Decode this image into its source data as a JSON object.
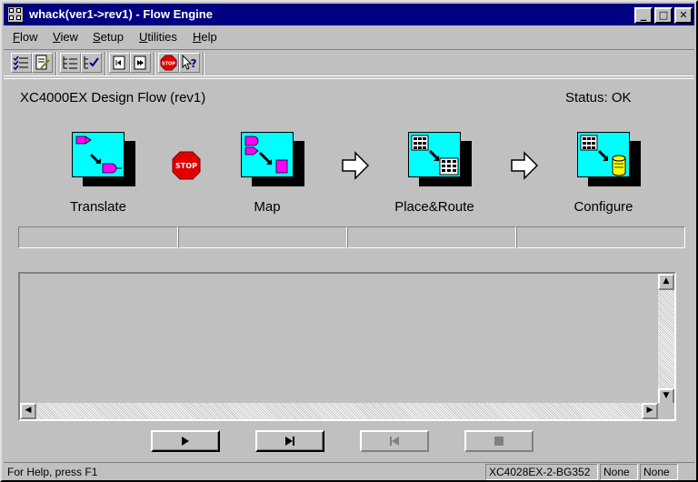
{
  "window": {
    "title": "whack(ver1->rev1) - Flow Engine",
    "minimize_label": "_",
    "maximize_label": "□",
    "close_label": "✕"
  },
  "menu": [
    {
      "key": "F",
      "rest": "low"
    },
    {
      "key": "V",
      "rest": "iew"
    },
    {
      "key": "S",
      "rest": "etup"
    },
    {
      "key": "U",
      "rest": "tilities"
    },
    {
      "key": "H",
      "rest": "elp"
    }
  ],
  "toolbar": {
    "icons": [
      "list-check-icon",
      "edit-doc-icon",
      "tree-list-icon",
      "tree-check-icon",
      "step-back-icon",
      "step-forward-icon",
      "stop-icon",
      "context-help-icon"
    ]
  },
  "main": {
    "heading": "XC4000EX Design Flow (rev1)",
    "status": "Status: OK",
    "steps": [
      {
        "label": "Translate"
      },
      {
        "label": "Map"
      },
      {
        "label": "Place&Route"
      },
      {
        "label": "Configure"
      }
    ],
    "stop_sign_text": "STOP"
  },
  "colors": {
    "title_bar": "#000080",
    "step_face": "#00ffff",
    "stop_red": "#e00000",
    "gate_magenta": "#ff00ff",
    "bit_yellow": "#ffff00"
  },
  "statusbar": {
    "help": "For Help, press F1",
    "device": "XC4028EX-2-BG352",
    "field2": "None",
    "field3": "None"
  }
}
